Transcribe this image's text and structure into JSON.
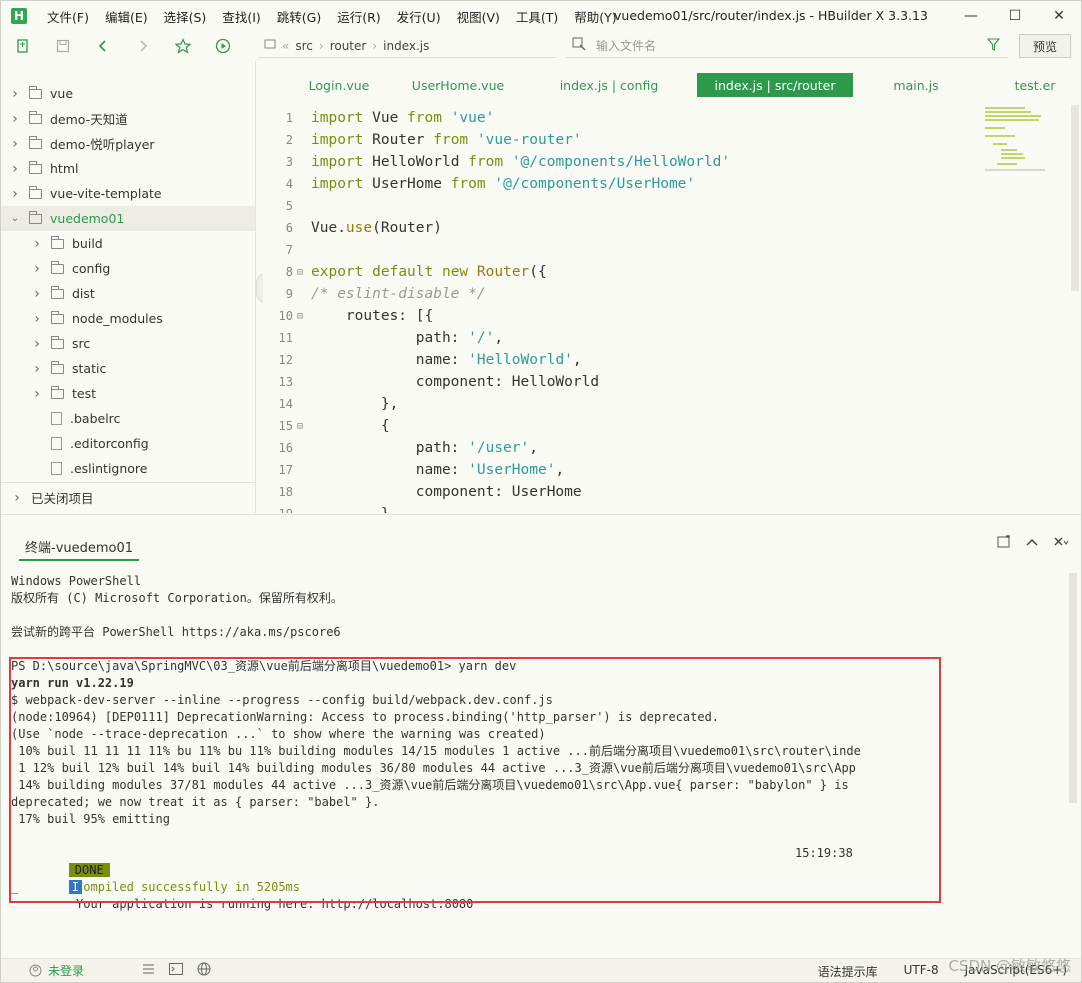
{
  "app": {
    "logo": "H",
    "window_title": "vuedemo01/src/router/index.js - HBuilder X 3.3.13",
    "menu": [
      "文件(F)",
      "编辑(E)",
      "选择(S)",
      "查找(I)",
      "跳转(G)",
      "运行(R)",
      "发行(U)",
      "视图(V)",
      "工具(T)",
      "帮助(Y)"
    ],
    "window_buttons": {
      "minimize": "—",
      "maximize": "☐",
      "close": "✕"
    }
  },
  "toolbar": {
    "breadcrumb": [
      "src",
      "router",
      "index.js"
    ],
    "search_placeholder": "输入文件名",
    "preview_label": "预览"
  },
  "sidebar": {
    "items": [
      {
        "label": "vue",
        "type": "folder",
        "expanded": false,
        "depth": 0
      },
      {
        "label": "demo-天知道",
        "type": "folder",
        "expanded": false,
        "depth": 0
      },
      {
        "label": "demo-悦听player",
        "type": "folder",
        "expanded": false,
        "depth": 0
      },
      {
        "label": "html",
        "type": "folder",
        "expanded": false,
        "depth": 0
      },
      {
        "label": "vue-vite-template",
        "type": "folder",
        "expanded": false,
        "depth": 0
      },
      {
        "label": "vuedemo01",
        "type": "folder",
        "expanded": true,
        "depth": 0,
        "selected": true
      },
      {
        "label": "build",
        "type": "folder",
        "expanded": false,
        "depth": 1
      },
      {
        "label": "config",
        "type": "folder",
        "expanded": false,
        "depth": 1
      },
      {
        "label": "dist",
        "type": "folder",
        "expanded": false,
        "depth": 1
      },
      {
        "label": "node_modules",
        "type": "folder",
        "expanded": false,
        "depth": 1
      },
      {
        "label": "src",
        "type": "folder",
        "expanded": false,
        "depth": 1
      },
      {
        "label": "static",
        "type": "folder",
        "expanded": false,
        "depth": 1
      },
      {
        "label": "test",
        "type": "folder",
        "expanded": false,
        "depth": 1
      },
      {
        "label": ".babelrc",
        "type": "file",
        "depth": 1
      },
      {
        "label": ".editorconfig",
        "type": "file",
        "depth": 1
      },
      {
        "label": ".eslintignore",
        "type": "file",
        "depth": 1
      }
    ],
    "closed_projects": "已关闭项目"
  },
  "editor": {
    "tabs": [
      {
        "label": "Login.vue",
        "active": false
      },
      {
        "label": "UserHome.vue",
        "active": false
      },
      {
        "label": "index.js | config",
        "active": false
      },
      {
        "label": "index.js | src/router",
        "active": true
      },
      {
        "label": "main.js",
        "active": false
      },
      {
        "label": "test.er",
        "active": false
      }
    ],
    "lines": [
      {
        "n": "1",
        "fold": "",
        "segs": [
          [
            "kw",
            "import"
          ],
          [
            "",
            " Vue "
          ],
          [
            "kw",
            "from"
          ],
          [
            "",
            " "
          ],
          [
            "str",
            "'vue'"
          ]
        ]
      },
      {
        "n": "2",
        "fold": "",
        "segs": [
          [
            "kw",
            "import"
          ],
          [
            "",
            " Router "
          ],
          [
            "kw",
            "from"
          ],
          [
            "",
            " "
          ],
          [
            "str",
            "'vue-router'"
          ]
        ]
      },
      {
        "n": "3",
        "fold": "",
        "segs": [
          [
            "kw",
            "import"
          ],
          [
            "",
            " HelloWorld "
          ],
          [
            "kw",
            "from"
          ],
          [
            "",
            " "
          ],
          [
            "str",
            "'@/components/HelloWorld'"
          ]
        ]
      },
      {
        "n": "4",
        "fold": "",
        "segs": [
          [
            "kw",
            "import"
          ],
          [
            "",
            " UserHome "
          ],
          [
            "kw",
            "from"
          ],
          [
            "",
            " "
          ],
          [
            "str",
            "'@/components/UserHome'"
          ]
        ]
      },
      {
        "n": "5",
        "fold": "",
        "segs": []
      },
      {
        "n": "6",
        "fold": "",
        "segs": [
          [
            "",
            "Vue."
          ],
          [
            "fn",
            "use"
          ],
          [
            "",
            "(Router)"
          ]
        ]
      },
      {
        "n": "7",
        "fold": "",
        "segs": []
      },
      {
        "n": "8",
        "fold": "⊟",
        "segs": [
          [
            "kw",
            "export"
          ],
          [
            "",
            " "
          ],
          [
            "kw",
            "default"
          ],
          [
            "",
            " "
          ],
          [
            "kw",
            "new"
          ],
          [
            "",
            " "
          ],
          [
            "fn",
            "Router"
          ],
          [
            "",
            "({"
          ]
        ]
      },
      {
        "n": "9",
        "fold": "",
        "segs": [
          [
            "cmt",
            "/* eslint-disable */"
          ]
        ]
      },
      {
        "n": "10",
        "fold": "⊟",
        "segs": [
          [
            "",
            "    routes: [{"
          ]
        ]
      },
      {
        "n": "11",
        "fold": "",
        "segs": [
          [
            "",
            "            path: "
          ],
          [
            "str",
            "'/'"
          ],
          [
            "",
            ","
          ]
        ]
      },
      {
        "n": "12",
        "fold": "",
        "segs": [
          [
            "",
            "            name: "
          ],
          [
            "str",
            "'HelloWorld'"
          ],
          [
            "",
            ","
          ]
        ]
      },
      {
        "n": "13",
        "fold": "",
        "segs": [
          [
            "",
            "            component: HelloWorld"
          ]
        ]
      },
      {
        "n": "14",
        "fold": "",
        "segs": [
          [
            "",
            "        },"
          ]
        ]
      },
      {
        "n": "15",
        "fold": "⊟",
        "segs": [
          [
            "",
            "        {"
          ]
        ]
      },
      {
        "n": "16",
        "fold": "",
        "segs": [
          [
            "",
            "            path: "
          ],
          [
            "str",
            "'/user'"
          ],
          [
            "",
            ","
          ]
        ]
      },
      {
        "n": "17",
        "fold": "",
        "segs": [
          [
            "",
            "            name: "
          ],
          [
            "str",
            "'UserHome'"
          ],
          [
            "",
            ","
          ]
        ]
      },
      {
        "n": "18",
        "fold": "",
        "segs": [
          [
            "",
            "            component: UserHome"
          ]
        ]
      },
      {
        "n": "19",
        "fold": "",
        "segs": [
          [
            "",
            "        }"
          ]
        ]
      }
    ]
  },
  "terminal": {
    "tab_label": "终端-vuedemo01",
    "lines": [
      "Windows PowerShell",
      "版权所有 (C) Microsoft Corporation。保留所有权利。",
      "",
      "尝试新的跨平台 PowerShell https://aka.ms/pscore6",
      "",
      "PS D:\\source\\java\\SpringMVC\\03_资源\\vue前后端分离项目\\vuedemo01> yarn dev",
      "yarn run v1.22.19",
      "$ webpack-dev-server --inline --progress --config build/webpack.dev.conf.js",
      "(node:10964) [DEP0111] DeprecationWarning: Access to process.binding('http_parser') is deprecated.",
      "(Use `node --trace-deprecation ...` to show where the warning was created)",
      " 10% buil 11 11 11 11% bu 11% bu 11% building modules 14/15 modules 1 active ...前后端分离项目\\vuedemo01\\src\\router\\inde",
      " 1 12% buil 12% buil 14% buil 14% building modules 36/80 modules 44 active ...3_资源\\vue前后端分离项目\\vuedemo01\\src\\App",
      " 14% building modules 37/81 modules 44 active ...3_资源\\vue前后端分离项目\\vuedemo01\\src\\App.vue{ parser: \"babylon\" } is",
      "deprecated; we now treat it as { parser: \"babel\" }.",
      " 17% buil 95% emitting"
    ],
    "done_badge": "DONE",
    "compiled_text": "Compiled successfully in 5205ms",
    "time": "15:19:38",
    "info_badge": "I",
    "running_text": "Your application is running here: http://localhost:8080",
    "cursor": "_"
  },
  "statusbar": {
    "login": "未登录",
    "hint": "语法提示库",
    "encoding": "UTF-8",
    "language": "JavaScript(ES6+)"
  },
  "watermark": "CSDN @敏敏悠悠",
  "colors": {
    "accent": "#2c9a4a",
    "highlight_box": "#e33b3b",
    "done_badge": "#7b8e0e",
    "info_badge": "#2b79c8"
  }
}
